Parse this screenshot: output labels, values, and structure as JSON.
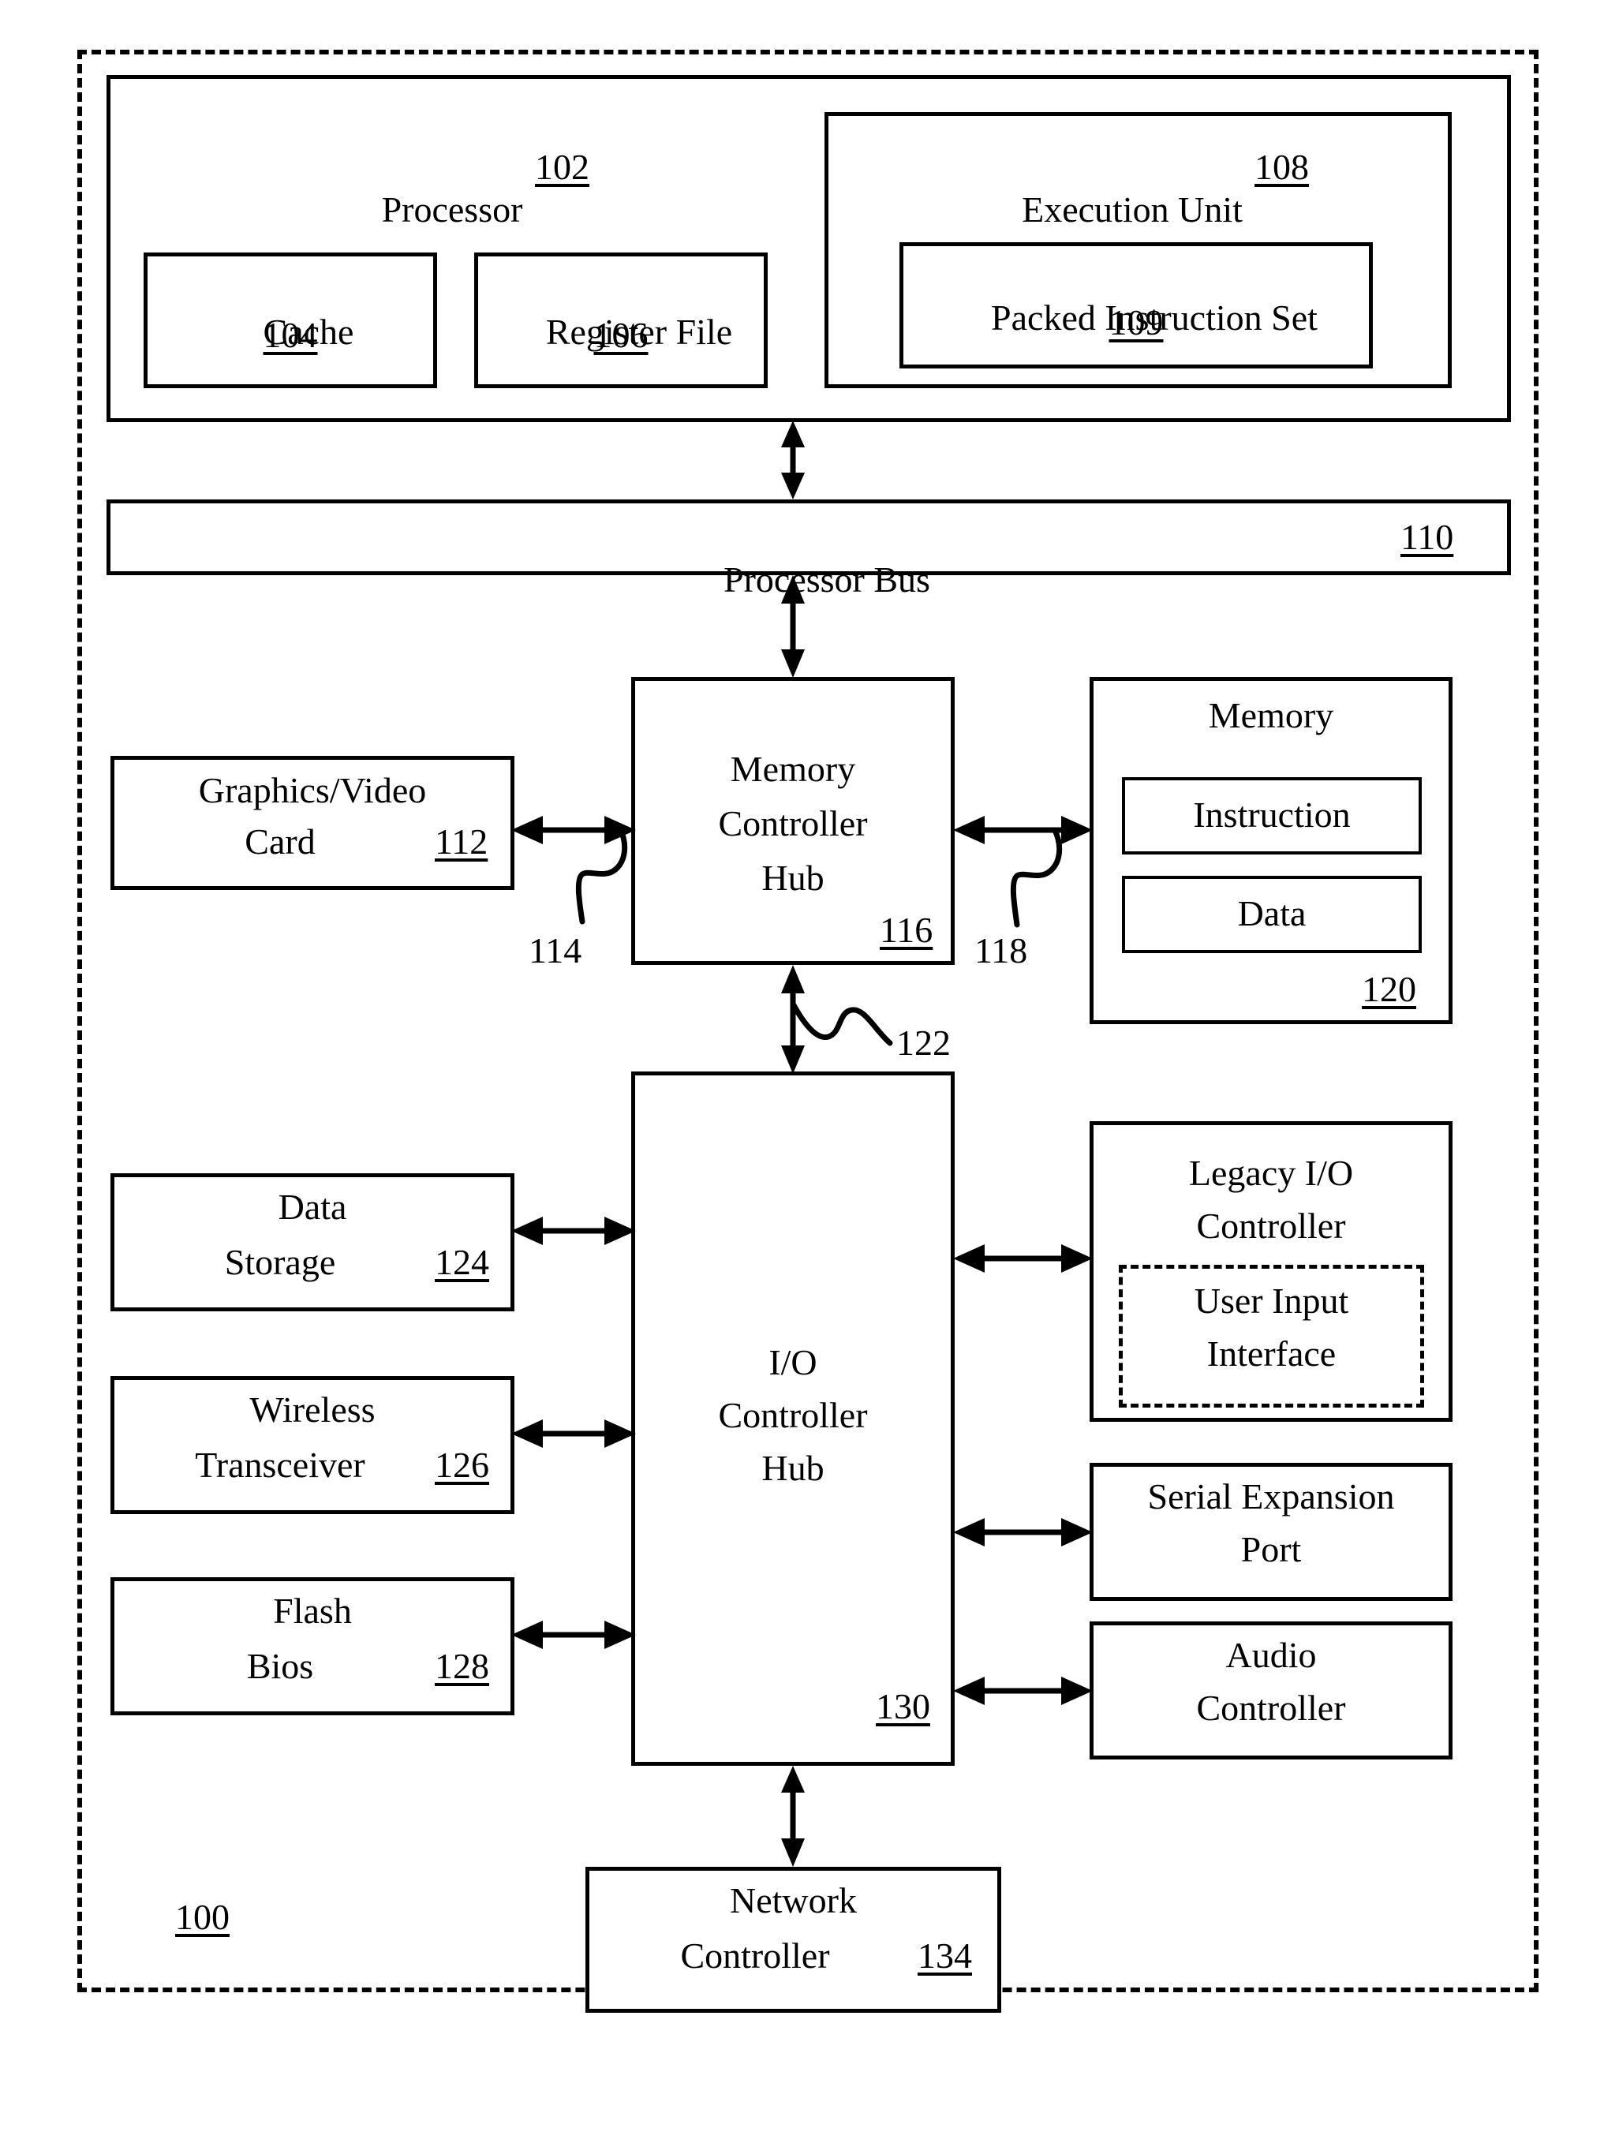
{
  "figure": {
    "system_ref": "100"
  },
  "processor": {
    "title": "Processor",
    "ref": "102",
    "cache": {
      "label": "Cache",
      "ref": "104"
    },
    "register_file": {
      "label": "Register File",
      "ref": "106"
    },
    "execution_unit": {
      "label": "Execution Unit",
      "ref": "108",
      "packed_instruction_set": {
        "label": "Packed Instruction Set",
        "ref": "109"
      }
    }
  },
  "processor_bus": {
    "label": "Processor Bus",
    "ref": "110"
  },
  "graphics_card": {
    "line1": "Graphics/Video",
    "line2": "Card",
    "ref": "112"
  },
  "memory_controller_hub": {
    "line1": "Memory",
    "line2": "Controller",
    "line3": "Hub",
    "ref": "116"
  },
  "memory": {
    "title": "Memory",
    "ref": "120",
    "instruction": "Instruction",
    "data": "Data"
  },
  "io_controller_hub": {
    "line1": "I/O",
    "line2": "Controller",
    "line3": "Hub",
    "ref": "130"
  },
  "data_storage": {
    "line1": "Data",
    "line2": "Storage",
    "ref": "124"
  },
  "wireless_transceiver": {
    "line1": "Wireless",
    "line2": "Transceiver",
    "ref": "126"
  },
  "flash_bios": {
    "line1": "Flash",
    "line2": "Bios",
    "ref": "128"
  },
  "legacy_io_controller": {
    "line1": "Legacy I/O",
    "line2": "Controller",
    "user_input_interface": {
      "line1": "User Input",
      "line2": "Interface"
    }
  },
  "serial_expansion_port": {
    "line1": "Serial Expansion",
    "line2": "Port"
  },
  "audio_controller": {
    "line1": "Audio",
    "line2": "Controller"
  },
  "network_controller": {
    "line1": "Network",
    "line2": "Controller",
    "ref": "134"
  },
  "lead_lines": {
    "graphics_to_mch": "114",
    "mch_to_memory": "118",
    "mch_to_ich": "122"
  }
}
